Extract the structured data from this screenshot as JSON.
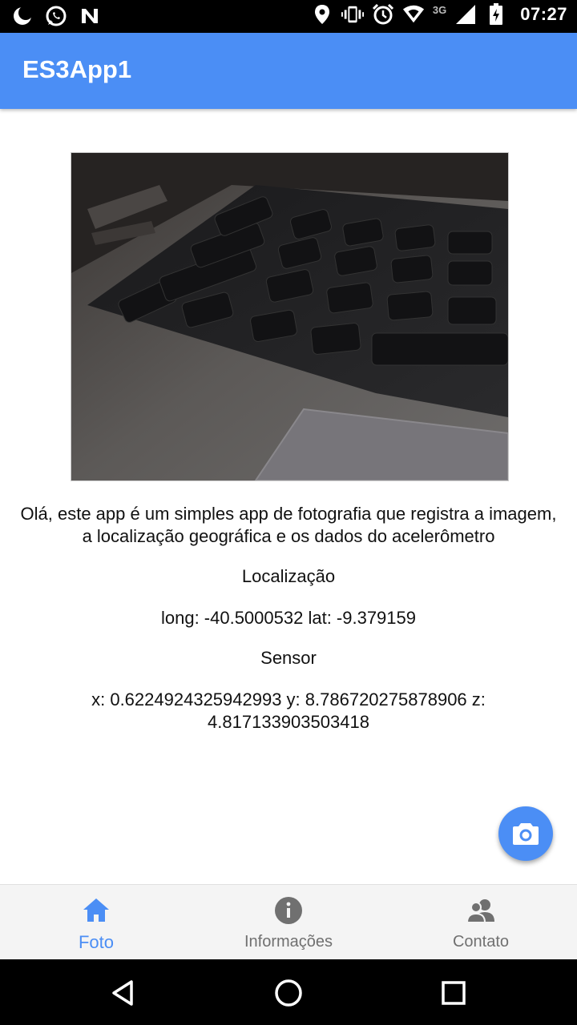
{
  "status_bar": {
    "time": "07:27",
    "network": "3G",
    "left_icons": [
      "moon-icon",
      "whatsapp-icon",
      "n-app-icon"
    ],
    "right_icons": [
      "location-icon",
      "vibrate-icon",
      "alarm-icon",
      "wifi-icon",
      "signal-icon",
      "battery-icon"
    ]
  },
  "app_bar": {
    "title": "ES3App1"
  },
  "photo": {
    "description_icon": "laptop-keyboard-photo"
  },
  "content": {
    "intro": "Olá, este app é um simples app de fotografia que registra a imagem, a localização geográfica e os dados do acelerômetro",
    "location_title": "Localização",
    "location_value": "long: -40.5000532 lat: -9.379159",
    "sensor_title": "Sensor",
    "sensor_value": "x: 0.6224924325942993 y: 8.786720275878906 z: 4.817133903503418"
  },
  "fab": {
    "icon": "camera-icon"
  },
  "bottom_nav": {
    "tabs": [
      {
        "label": "Foto",
        "icon": "home-icon",
        "active": true
      },
      {
        "label": "Informações",
        "icon": "info-icon",
        "active": false
      },
      {
        "label": "Contato",
        "icon": "contacts-icon",
        "active": false
      }
    ]
  },
  "colors": {
    "primary": "#4b8ef5",
    "inactive": "#707070"
  }
}
